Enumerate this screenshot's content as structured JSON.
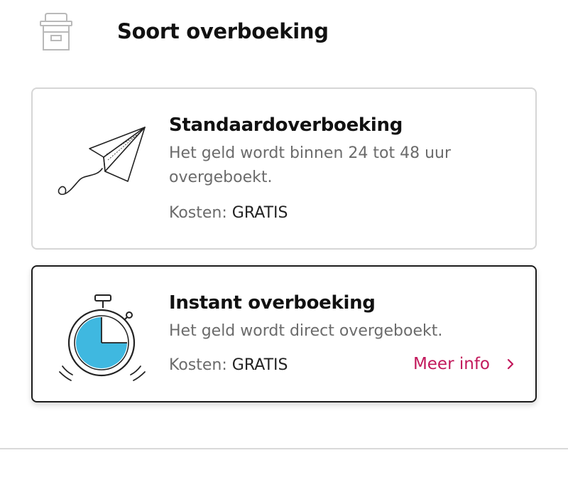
{
  "header": {
    "title": "Soort overboeking",
    "icon": "mailbox-icon"
  },
  "options": [
    {
      "title": "Standaardoverboeking",
      "description": "Het geld wordt binnen 24 tot 48 uur overgeboekt.",
      "cost_label": "Kosten:",
      "cost_value": "GRATIS",
      "icon": "paper-plane-icon",
      "selected": false
    },
    {
      "title": "Instant overboeking",
      "description": "Het geld wordt direct overgeboekt.",
      "cost_label": "Kosten:",
      "cost_value": "GRATIS",
      "icon": "stopwatch-icon",
      "selected": true,
      "more_info_label": "Meer info",
      "more_info_icon": "chevron-right-icon"
    }
  ],
  "colors": {
    "accent": "#c2185b",
    "stopwatch_fill": "#3fb8e0",
    "selected_border": "#1c1c1c",
    "unselected_border": "#d6d6d6"
  }
}
